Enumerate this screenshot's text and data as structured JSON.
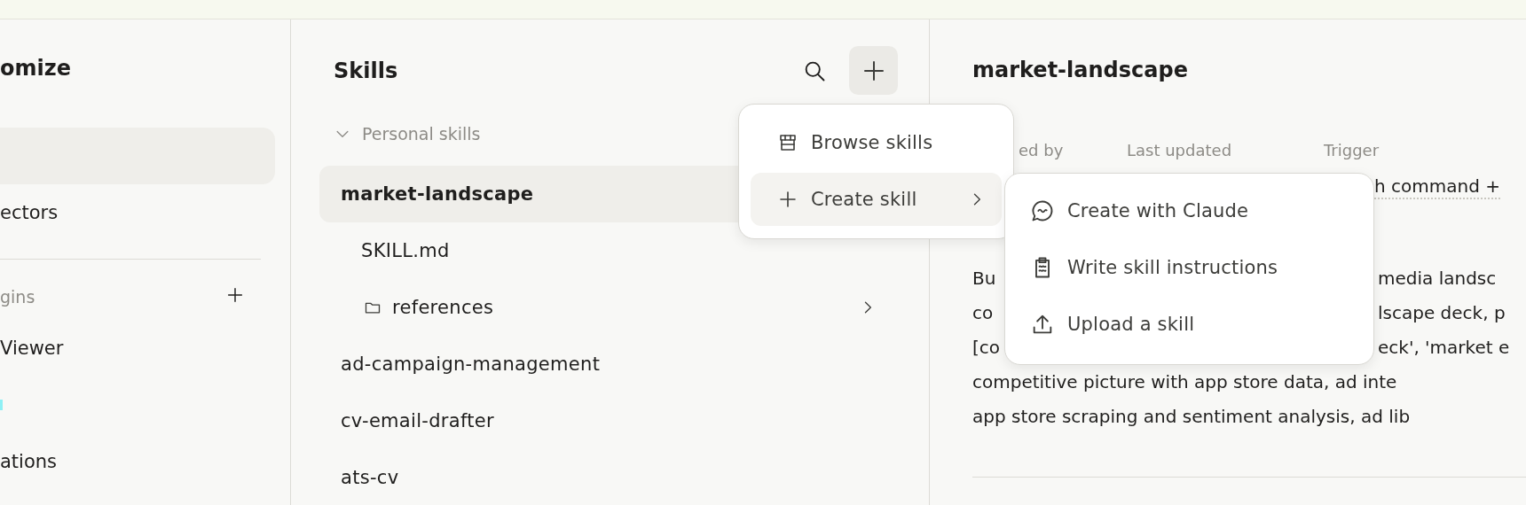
{
  "customize_nav": {
    "title": "omize",
    "items": [
      {
        "selected": true
      },
      {
        "label": "ectors",
        "selected": false
      }
    ],
    "plugins": {
      "label": "gins",
      "items": [
        {
          "kind": "text",
          "label": "Viewer"
        },
        {
          "kind": "marker"
        },
        {
          "kind": "text",
          "label": "ations"
        }
      ]
    }
  },
  "skills_panel": {
    "title": "Skills",
    "section": {
      "label": "Personal skills",
      "expanded": true
    },
    "skills": [
      {
        "label": "market-landscape",
        "selected": true,
        "children": [
          {
            "kind": "file",
            "label": "SKILL.md"
          },
          {
            "kind": "folder",
            "label": "references"
          }
        ]
      },
      {
        "label": "ad-campaign-management",
        "selected": false
      },
      {
        "label": "cv-email-drafter",
        "selected": false
      },
      {
        "label": "ats-cv",
        "selected": false
      }
    ]
  },
  "skill_detail": {
    "title": "market-landscape",
    "meta": [
      {
        "label": "ed by"
      },
      {
        "label": "Last updated"
      },
      {
        "label": "Trigger",
        "value": "h command +"
      }
    ],
    "description_lines": [
      {
        "left": "Bu",
        "right": "media landsc"
      },
      {
        "left": "co",
        "right": "lscape deck, p"
      },
      {
        "left": "[co",
        "right": "eck', 'market e"
      },
      {
        "left": "competitive picture with app store data, ad inte"
      },
      {
        "left": "app store scraping and sentiment analysis, ad lib"
      }
    ]
  },
  "add_menu": {
    "items": [
      {
        "label": "Browse skills",
        "highlighted": false,
        "has_submenu": false
      },
      {
        "label": "Create skill",
        "highlighted": true,
        "has_submenu": true
      }
    ]
  },
  "create_submenu": {
    "items": [
      {
        "label": "Create with Claude"
      },
      {
        "label": "Write skill instructions"
      },
      {
        "label": "Upload a skill"
      }
    ]
  }
}
